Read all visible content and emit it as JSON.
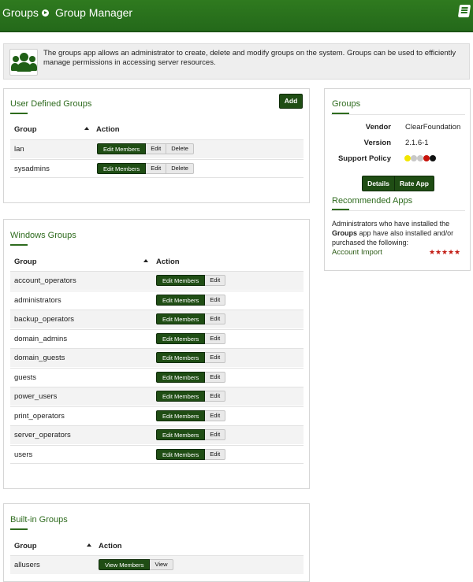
{
  "header": {
    "breadcrumb_root": "Groups",
    "page_title": "Group Manager"
  },
  "intro": {
    "text": "The groups app allows an administrator to create, delete and modify groups on the system. Groups can be used to efficiently manage permissions in accessing server resources."
  },
  "user_groups": {
    "title": "User Defined Groups",
    "add_label": "Add",
    "col_group": "Group",
    "col_action": "Action",
    "rows": [
      {
        "name": "lan",
        "actions": [
          "Edit Members",
          "Edit",
          "Delete"
        ]
      },
      {
        "name": "sysadmins",
        "actions": [
          "Edit Members",
          "Edit",
          "Delete"
        ]
      }
    ]
  },
  "windows_groups": {
    "title": "Windows Groups",
    "col_group": "Group",
    "col_action": "Action",
    "rows": [
      {
        "name": "account_operators",
        "actions": [
          "Edit Members",
          "Edit"
        ]
      },
      {
        "name": "administrators",
        "actions": [
          "Edit Members",
          "Edit"
        ]
      },
      {
        "name": "backup_operators",
        "actions": [
          "Edit Members",
          "Edit"
        ]
      },
      {
        "name": "domain_admins",
        "actions": [
          "Edit Members",
          "Edit"
        ]
      },
      {
        "name": "domain_guests",
        "actions": [
          "Edit Members",
          "Edit"
        ]
      },
      {
        "name": "guests",
        "actions": [
          "Edit Members",
          "Edit"
        ]
      },
      {
        "name": "power_users",
        "actions": [
          "Edit Members",
          "Edit"
        ]
      },
      {
        "name": "print_operators",
        "actions": [
          "Edit Members",
          "Edit"
        ]
      },
      {
        "name": "server_operators",
        "actions": [
          "Edit Members",
          "Edit"
        ]
      },
      {
        "name": "users",
        "actions": [
          "Edit Members",
          "Edit"
        ]
      }
    ]
  },
  "builtin_groups": {
    "title": "Built-in Groups",
    "col_group": "Group",
    "col_action": "Action",
    "rows": [
      {
        "name": "allusers",
        "actions": [
          "View Members",
          "View"
        ]
      }
    ]
  },
  "sidebar": {
    "title": "Groups",
    "vendor_label": "Vendor",
    "vendor_value": "ClearFoundation",
    "version_label": "Version",
    "version_value": "2.1.6-1",
    "support_label": "Support Policy",
    "support_dots": [
      "#f2e600",
      "#c8c8c8",
      "#c8c8c8",
      "#c8140c",
      "#111111"
    ],
    "details_label": "Details",
    "rate_label": "Rate App",
    "recommended_title": "Recommended Apps",
    "recommended_text_before": "Administrators who have installed the",
    "recommended_app_bold": "Groups",
    "recommended_text_after": "app have also installed and/or purchased the following:",
    "recommended_link": "Account Import",
    "recommended_rating": 5
  },
  "colors": {
    "header_green": "#2a7320",
    "button_dark_green": "#1f4d14",
    "title_green": "#2e6b1e",
    "star_red": "#c21a12"
  }
}
